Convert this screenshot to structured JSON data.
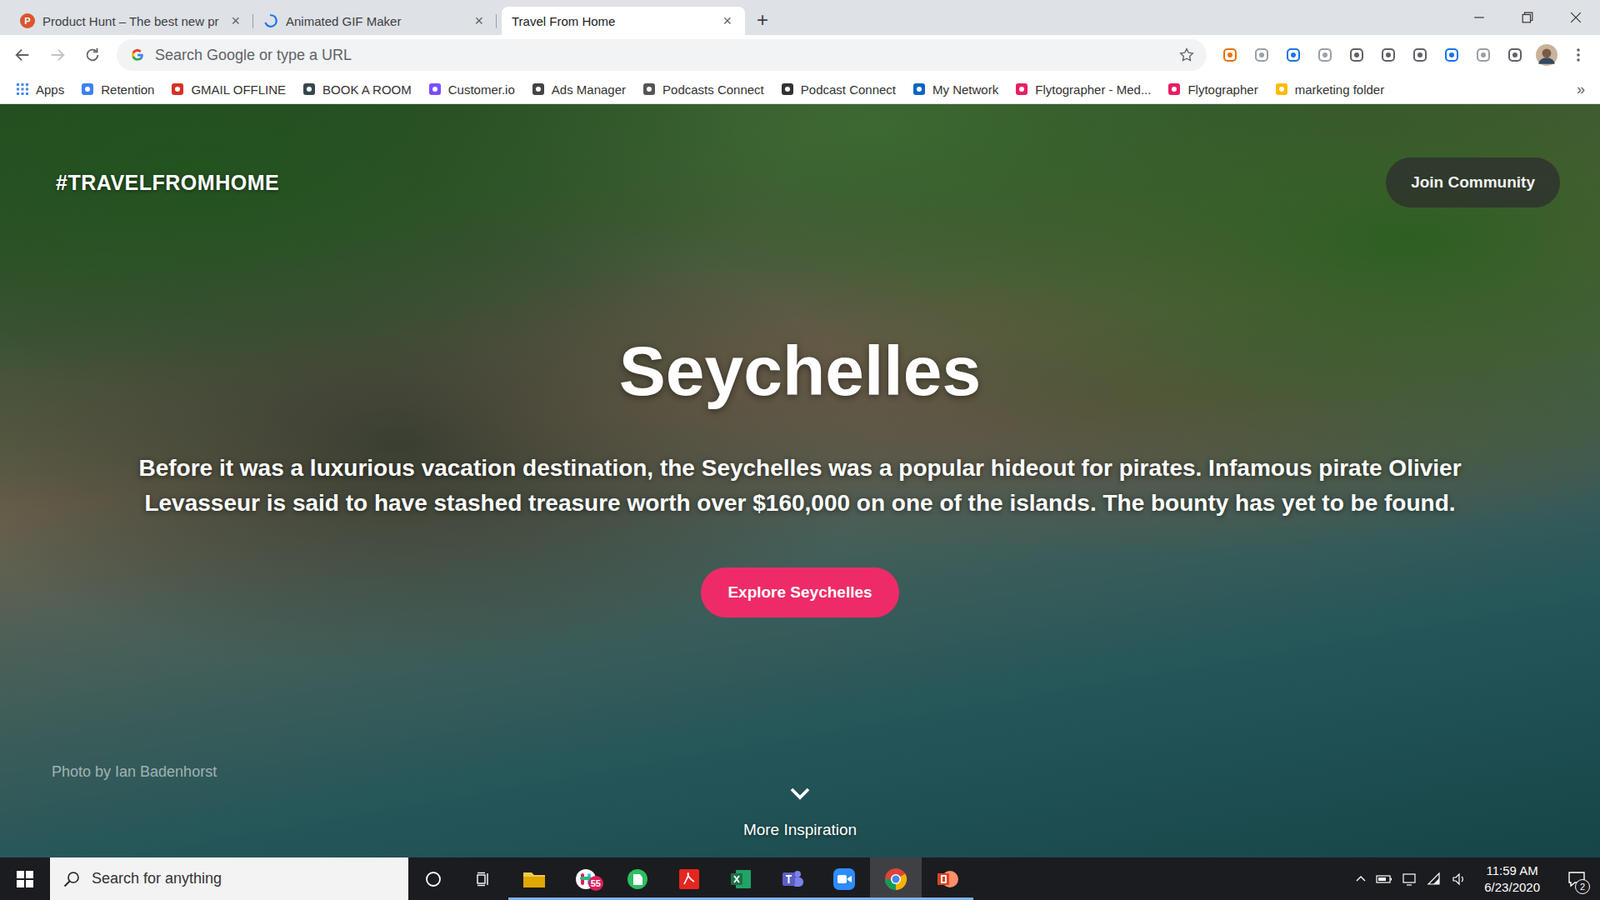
{
  "tabs": [
    {
      "label": "Product Hunt – The best new pr",
      "selected": false,
      "icon": "letter",
      "letter": "P",
      "close": "×"
    },
    {
      "label": "Animated GIF Maker",
      "selected": false,
      "icon": "spinner",
      "close": "×"
    },
    {
      "label": "Travel From Home",
      "selected": true,
      "icon": "none",
      "close": "×"
    }
  ],
  "new_tab": "+",
  "nav": {
    "back_enabled": true,
    "forward_enabled": false
  },
  "omnibox": {
    "placeholder": "Search Google or type a URL",
    "bookmarked": false
  },
  "bookmarks": {
    "items": [
      {
        "label": "Apps",
        "kind": "apps",
        "color": "#4285f4"
      },
      {
        "label": "Retention",
        "kind": "site",
        "color": "#3b82f6"
      },
      {
        "label": "GMAIL OFFLINE",
        "kind": "site",
        "color": "#d93025"
      },
      {
        "label": "BOOK A ROOM",
        "kind": "site",
        "color": "#37474f"
      },
      {
        "label": "Customer.io",
        "kind": "site",
        "color": "#7c4dff"
      },
      {
        "label": "Ads Manager",
        "kind": "site",
        "color": "#444444"
      },
      {
        "label": "Podcasts Connect",
        "kind": "site",
        "color": "#555555"
      },
      {
        "label": "Podcast Connect",
        "kind": "site",
        "color": "#333333"
      },
      {
        "label": "My Network",
        "kind": "site",
        "color": "#0a66c2"
      },
      {
        "label": "Flytographer - Med...",
        "kind": "site",
        "color": "#e91e63"
      },
      {
        "label": "Flytographer",
        "kind": "site",
        "color": "#e91e63"
      },
      {
        "label": "marketing folder",
        "kind": "site",
        "color": "#fbbc04"
      }
    ],
    "overflow": "»"
  },
  "page": {
    "logo": "#TRAVELFROMHOME",
    "join": "Join Community",
    "title": "Seychelles",
    "description": "Before it was a luxurious vacation destination, the Seychelles was a popular hideout for pirates. Infamous pirate Olivier Levasseur is said to have stashed treasure worth over $160,000 on one of the islands. The bounty has yet to be found.",
    "cta": "Explore Seychelles",
    "more": "More Inspiration",
    "credit": "Photo by Ian Badenhorst"
  },
  "taskbar": {
    "search_placeholder": "Search for anything",
    "apps": [
      {
        "kind": "explorer",
        "color": "#f2c94c",
        "running": true,
        "active": false
      },
      {
        "kind": "chat",
        "color": "#e01e5a",
        "running": true,
        "active": false,
        "badge": "55"
      },
      {
        "kind": "notes",
        "color": "#2dbe60",
        "running": true,
        "active": false
      },
      {
        "kind": "pdf",
        "color": "#e52620",
        "running": true,
        "active": false
      },
      {
        "kind": "sheet",
        "color": "#1d7044",
        "running": true,
        "active": false
      },
      {
        "kind": "teams",
        "color": "#5b5fc7",
        "running": true,
        "active": false
      },
      {
        "kind": "video",
        "color": "#2d8cff",
        "running": true,
        "active": false
      },
      {
        "kind": "browser",
        "color": "#4285f4",
        "running": true,
        "active": true
      },
      {
        "kind": "slides",
        "color": "#d24726",
        "running": true,
        "active": false
      }
    ],
    "time": "11:59 AM",
    "date": "6/23/2020",
    "notifications": "2"
  }
}
